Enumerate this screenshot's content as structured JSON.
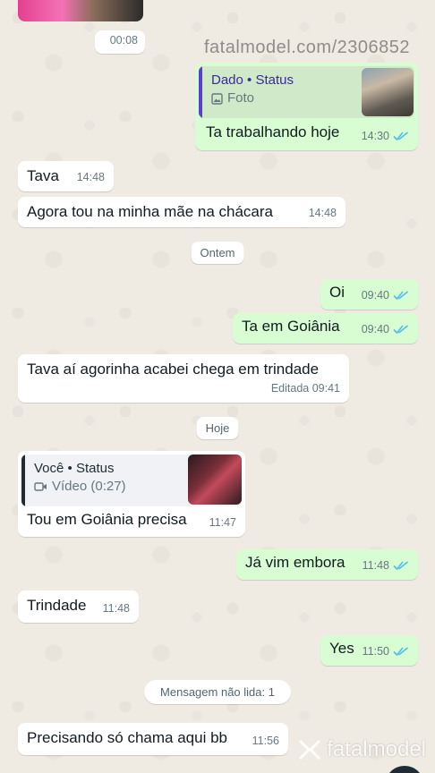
{
  "watermark": {
    "url": "fatalmodel.com/2306852",
    "logo_text": "fatalmodel"
  },
  "messages": {
    "m0_time": "00:08",
    "status_reply_1": {
      "title": "Dado • Status",
      "sub": "Foto",
      "text": "Ta trabalhando hoje",
      "time": "14:30"
    },
    "m2": {
      "text": "Tava",
      "time": "14:48"
    },
    "m3": {
      "text": "Agora tou na minha mãe na chácara",
      "time": "14:48"
    },
    "sep_ontem": "Ontem",
    "m4": {
      "text": "Oi",
      "time": "09:40"
    },
    "m5": {
      "text": "Ta em Goiânia",
      "time": "09:40"
    },
    "m6": {
      "text": "Tava aí agorinha acabei chega em trindade",
      "time": "Editada 09:41"
    },
    "sep_hoje": "Hoje",
    "status_reply_2": {
      "title": "Você • Status",
      "sub": "Vídeo (0:27)",
      "text": "Tou em Goiânia precisa",
      "time": "11:47"
    },
    "m8": {
      "text": "Já vim embora",
      "time": "11:48"
    },
    "m9": {
      "text": "Trindade",
      "time": "11:48"
    },
    "m10": {
      "text": "Yes",
      "time": "11:50"
    },
    "unread": "Mensagem não lida: 1",
    "m11": {
      "text": "Precisando só chama aqui bb",
      "time": "11:56"
    }
  },
  "colors": {
    "incoming": "#ffffff",
    "outgoing": "#d9fdd3",
    "read_ticks": "#53bdeb",
    "quote_out": "#cfe9c9",
    "quote_bar_out": "#5a3fd1",
    "quote_in": "#f0f2f5",
    "quote_bar_in": "#1f2c33"
  }
}
